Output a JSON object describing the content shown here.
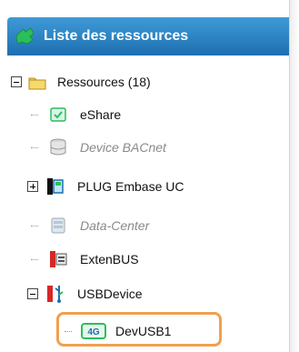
{
  "panel": {
    "title": "Liste des ressources",
    "icon": "tree-icon"
  },
  "tree": {
    "root": {
      "label": "Ressources (18)",
      "expander": "minus",
      "icon": "folder-icon"
    },
    "items": [
      {
        "label": "eShare",
        "icon": "eshare-icon",
        "disabled": false
      },
      {
        "label": "Device BACnet",
        "icon": "database-icon",
        "disabled": true
      },
      {
        "label": "PLUG Embase UC",
        "icon": "plug-icon",
        "disabled": false,
        "expander": "plus"
      },
      {
        "label": "Data-Center",
        "icon": "datacenter-icon",
        "disabled": true
      },
      {
        "label": "ExtenBUS",
        "icon": "extenbus-icon",
        "disabled": false
      },
      {
        "label": "USBDevice",
        "icon": "usb-icon",
        "disabled": false,
        "expander": "minus"
      }
    ],
    "child": {
      "label": "DevUSB1",
      "icon": "4g-icon",
      "badge_text": "4G",
      "selected": true
    }
  },
  "colors": {
    "header_top": "#3f9ad6",
    "header_bottom": "#1e6fb0",
    "selection_border": "#f0a050",
    "icon_green": "#2bbf5a",
    "icon_red": "#d72727"
  }
}
